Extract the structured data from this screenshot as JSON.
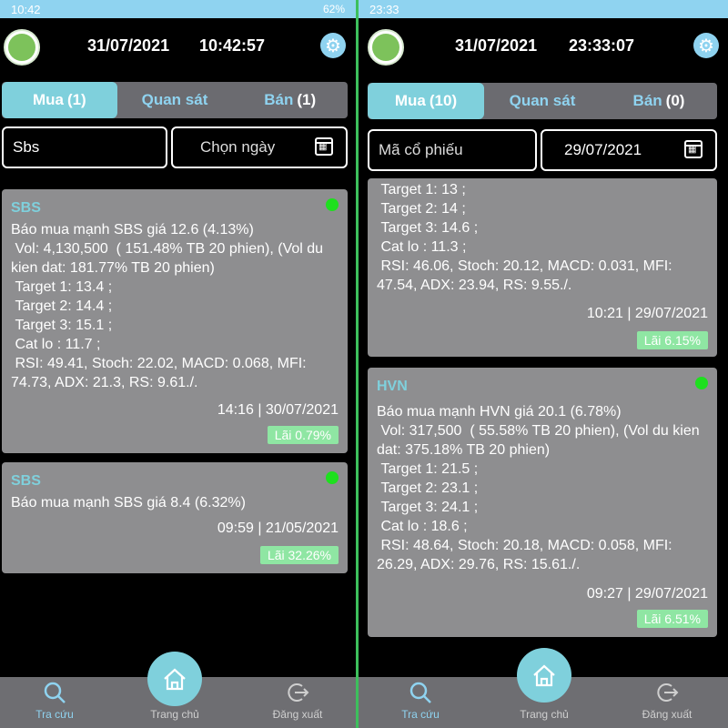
{
  "screens": [
    {
      "status": {
        "time": "10:42",
        "right": "62%"
      },
      "header": {
        "date": "31/07/2021",
        "time": "10:42:57"
      },
      "tabs": [
        {
          "label": "Mua",
          "count": "(1)"
        },
        {
          "label": "Quan sát",
          "count": ""
        },
        {
          "label": "Bán",
          "count": "(1)"
        }
      ],
      "search": {
        "value": "Sbs",
        "placeholder": "Mã cổ phiếu"
      },
      "date_field": {
        "value": "Chọn ngày"
      },
      "cards": [
        {
          "symbol": "SBS",
          "body": "Báo mua mạnh SBS giá 12.6 (4.13%)\n Vol: 4,130,500  ( 151.48% TB 20 phien), (Vol du kien dat: 181.77% TB 20 phien)\n Target 1: 13.4 ;\n Target 2: 14.4 ;\n Target 3: 15.1 ;\n Cat lo : 11.7 ;\n RSI: 49.41, Stoch: 22.02, MACD: 0.068, MFI: 74.73, ADX: 21.3, RS: 9.61./.",
          "timestamp": "14:16 | 30/07/2021",
          "badge": "Lãi 0.79%"
        },
        {
          "symbol": "SBS",
          "body": "Báo mua mạnh SBS giá 8.4 (6.32%)",
          "timestamp": "09:59 | 21/05/2021",
          "badge": "Lãi 32.26%"
        }
      ],
      "nav": {
        "search": "Tra cứu",
        "home": "Trang chủ",
        "logout": "Đăng xuất"
      }
    },
    {
      "status": {
        "time": "23:33",
        "right": ""
      },
      "header": {
        "date": "31/07/2021",
        "time": "23:33:07"
      },
      "tabs": [
        {
          "label": "Mua",
          "count": "(10)"
        },
        {
          "label": "Quan sát",
          "count": ""
        },
        {
          "label": "Bán",
          "count": "(0)"
        }
      ],
      "search": {
        "value": "",
        "placeholder": "Mã cổ phiếu"
      },
      "date_field": {
        "value": "29/07/2021"
      },
      "cards": [
        {
          "symbol": "",
          "body": " Target 1: 13 ;\n Target 2: 14 ;\n Target 3: 14.6 ;\n Cat lo : 11.3 ;\n RSI: 46.06, Stoch: 20.12, MACD: 0.031, MFI: 47.54, ADX: 23.94, RS: 9.55./.",
          "timestamp": "10:21 | 29/07/2021",
          "badge": "Lãi 6.15%"
        },
        {
          "symbol": "HVN",
          "body": "Báo mua mạnh HVN giá 20.1 (6.78%)\n Vol: 317,500  ( 55.58% TB 20 phien), (Vol du kien dat: 375.18% TB 20 phien)\n Target 1: 21.5 ;\n Target 2: 23.1 ;\n Target 3: 24.1 ;\n Cat lo : 18.6 ;\n RSI: 48.64, Stoch: 20.18, MACD: 0.058, MFI: 26.29, ADX: 29.76, RS: 15.61./.",
          "timestamp": "09:27 | 29/07/2021",
          "badge": "Lãi 6.51%"
        }
      ],
      "nav": {
        "search": "Tra cứu",
        "home": "Trang chủ",
        "logout": "Đăng xuất"
      }
    }
  ],
  "colors": {
    "accent": "#7fd0dc",
    "status_bar": "#8fd3f0",
    "card_bg": "#8e8e90",
    "badge": "#8fe6a3",
    "dot": "#1ee01e",
    "divider": "#3dbf5c"
  }
}
